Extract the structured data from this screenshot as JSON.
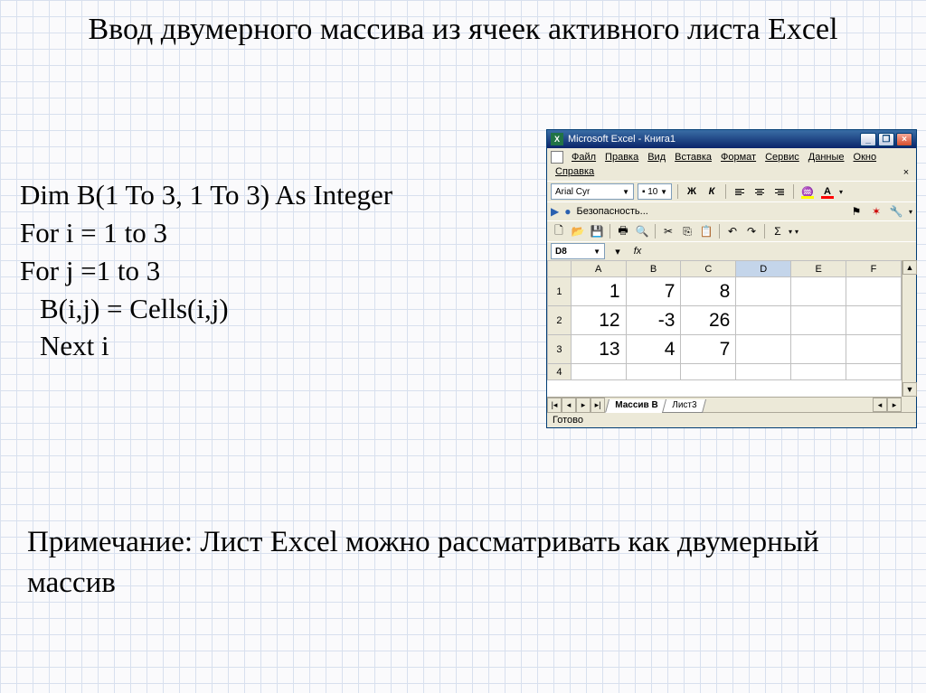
{
  "title": "Ввод двумерного массива из ячеек активного листа Excel",
  "code": {
    "line1": "Dim B(1 To 3, 1 To 3) As Integer",
    "line2": "For i = 1 to 3",
    "line3": "For j =1 to 3",
    "line4": "B(i,j) = Cells(i,j)",
    "line5": "Next i"
  },
  "note": "Примечание: Лист Excel можно рассматривать как двумерный массив",
  "excel": {
    "titlebar": "Microsoft Excel - Книга1",
    "menu": {
      "file": "Файл",
      "edit": "Правка",
      "view": "Вид",
      "insert": "Вставка",
      "format": "Формат",
      "tools": "Сервис",
      "data": "Данные",
      "window": "Окно",
      "help": "Справка"
    },
    "font_name": "Arial Cyr",
    "font_size": "10",
    "bold": "Ж",
    "italic": "К",
    "security": "Безопасность...",
    "namebox": "D8",
    "fx": "fx",
    "columns": [
      "A",
      "B",
      "C",
      "D",
      "E",
      "F"
    ],
    "rows": [
      {
        "n": "1",
        "cells": [
          "1",
          "7",
          "8",
          "",
          "",
          ""
        ]
      },
      {
        "n": "2",
        "cells": [
          "12",
          "-3",
          "26",
          "",
          "",
          ""
        ]
      },
      {
        "n": "3",
        "cells": [
          "13",
          "4",
          "7",
          "",
          "",
          ""
        ]
      },
      {
        "n": "4",
        "cells": [
          "",
          "",
          "",
          "",
          "",
          ""
        ]
      }
    ],
    "tabs": {
      "active": "Массив В",
      "other": "Лист3"
    },
    "status": "Готово"
  }
}
